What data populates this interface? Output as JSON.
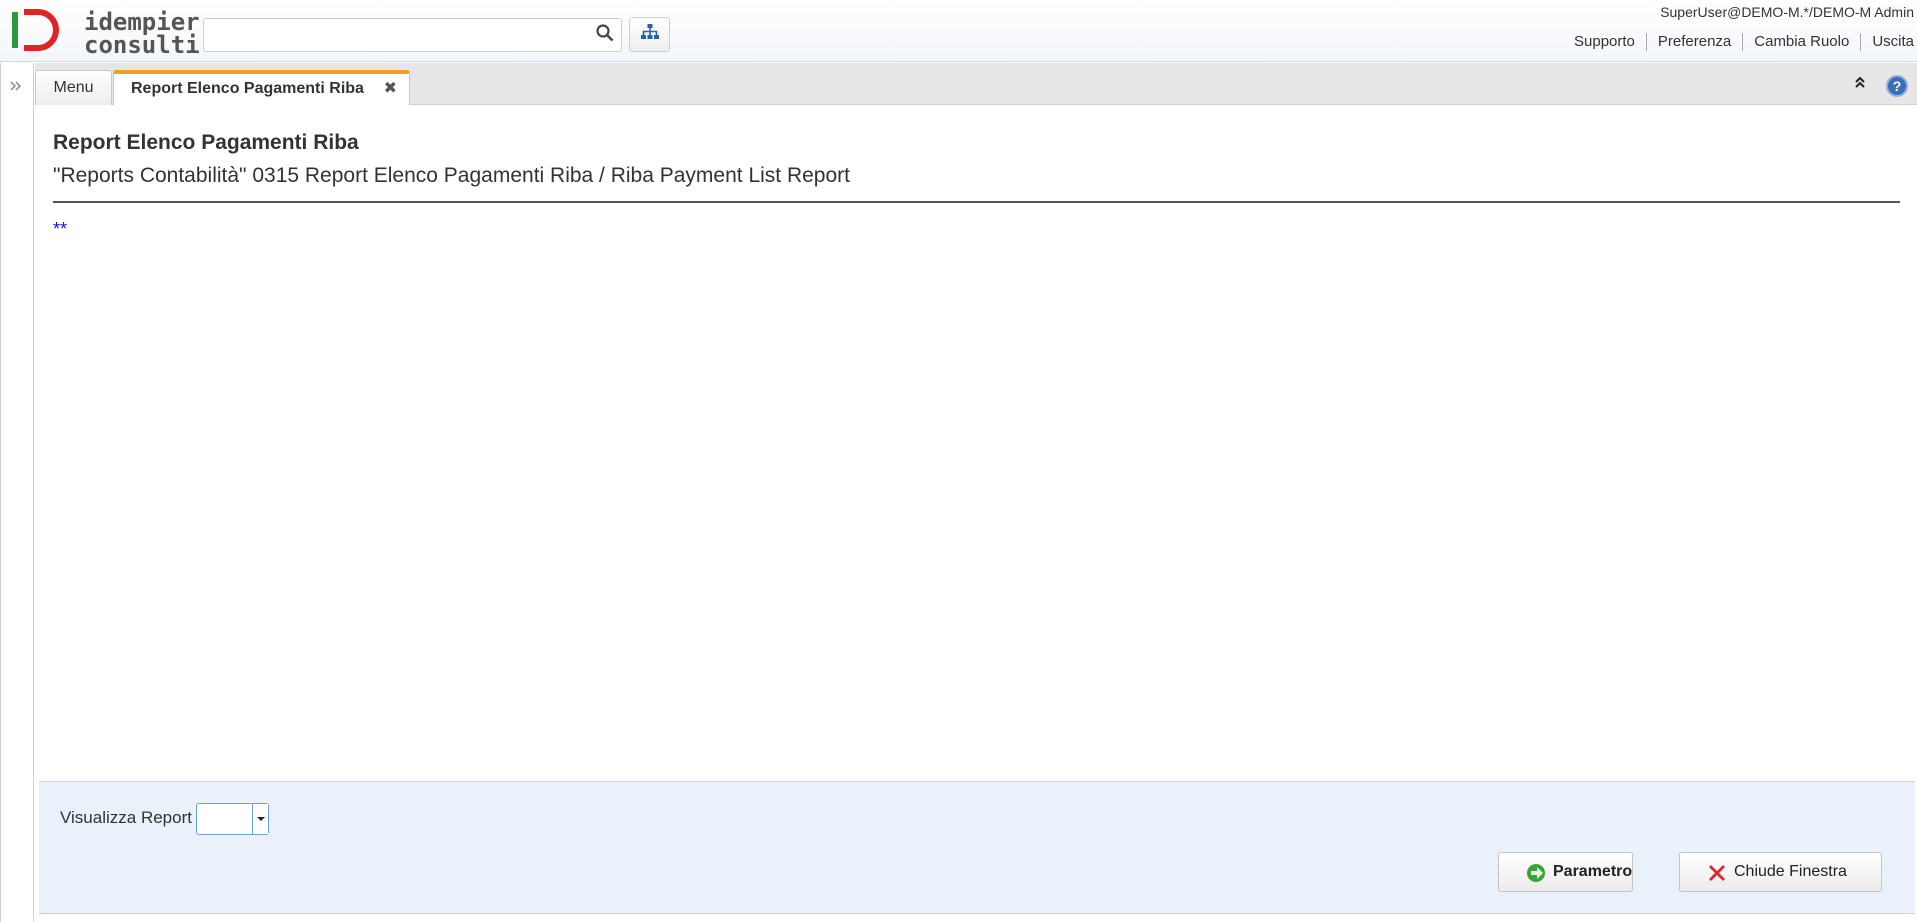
{
  "header": {
    "logo_text_line1": "idempiere",
    "logo_text_line2": "consulting",
    "search_placeholder": "",
    "user_info": "SuperUser@DEMO-M.*/DEMO-M Admin",
    "links": [
      "Supporto",
      "Preferenza",
      "Cambia Ruolo",
      "Uscita"
    ]
  },
  "tabs": {
    "menu_label": "Menu",
    "active_label": "Report Elenco Pagamenti Riba"
  },
  "process": {
    "title": "Report Elenco Pagamenti Riba",
    "subtitle": "\"Reports Contabilità\" 0315 Report Elenco Pagamenti Riba / Riba Payment List Report",
    "required_mark": "**"
  },
  "footer": {
    "visualizza_label": "Visualizza Report",
    "visualizza_value": "",
    "param_button": "Parametro",
    "close_button": "Chiude Finestra"
  },
  "colors": {
    "accent_orange": "#f39c1f",
    "logo_green": "#2a9a3c",
    "logo_red": "#e02424",
    "required_blue": "#1010e0",
    "panel_bg": "#eaf1fb"
  },
  "icons": [
    "search-icon",
    "tree-menu-icon",
    "expand-panel-icon",
    "close-tab-icon",
    "collapse-icon",
    "help-icon",
    "dropdown-caret-icon",
    "param-arrow-icon",
    "close-x-icon"
  ]
}
